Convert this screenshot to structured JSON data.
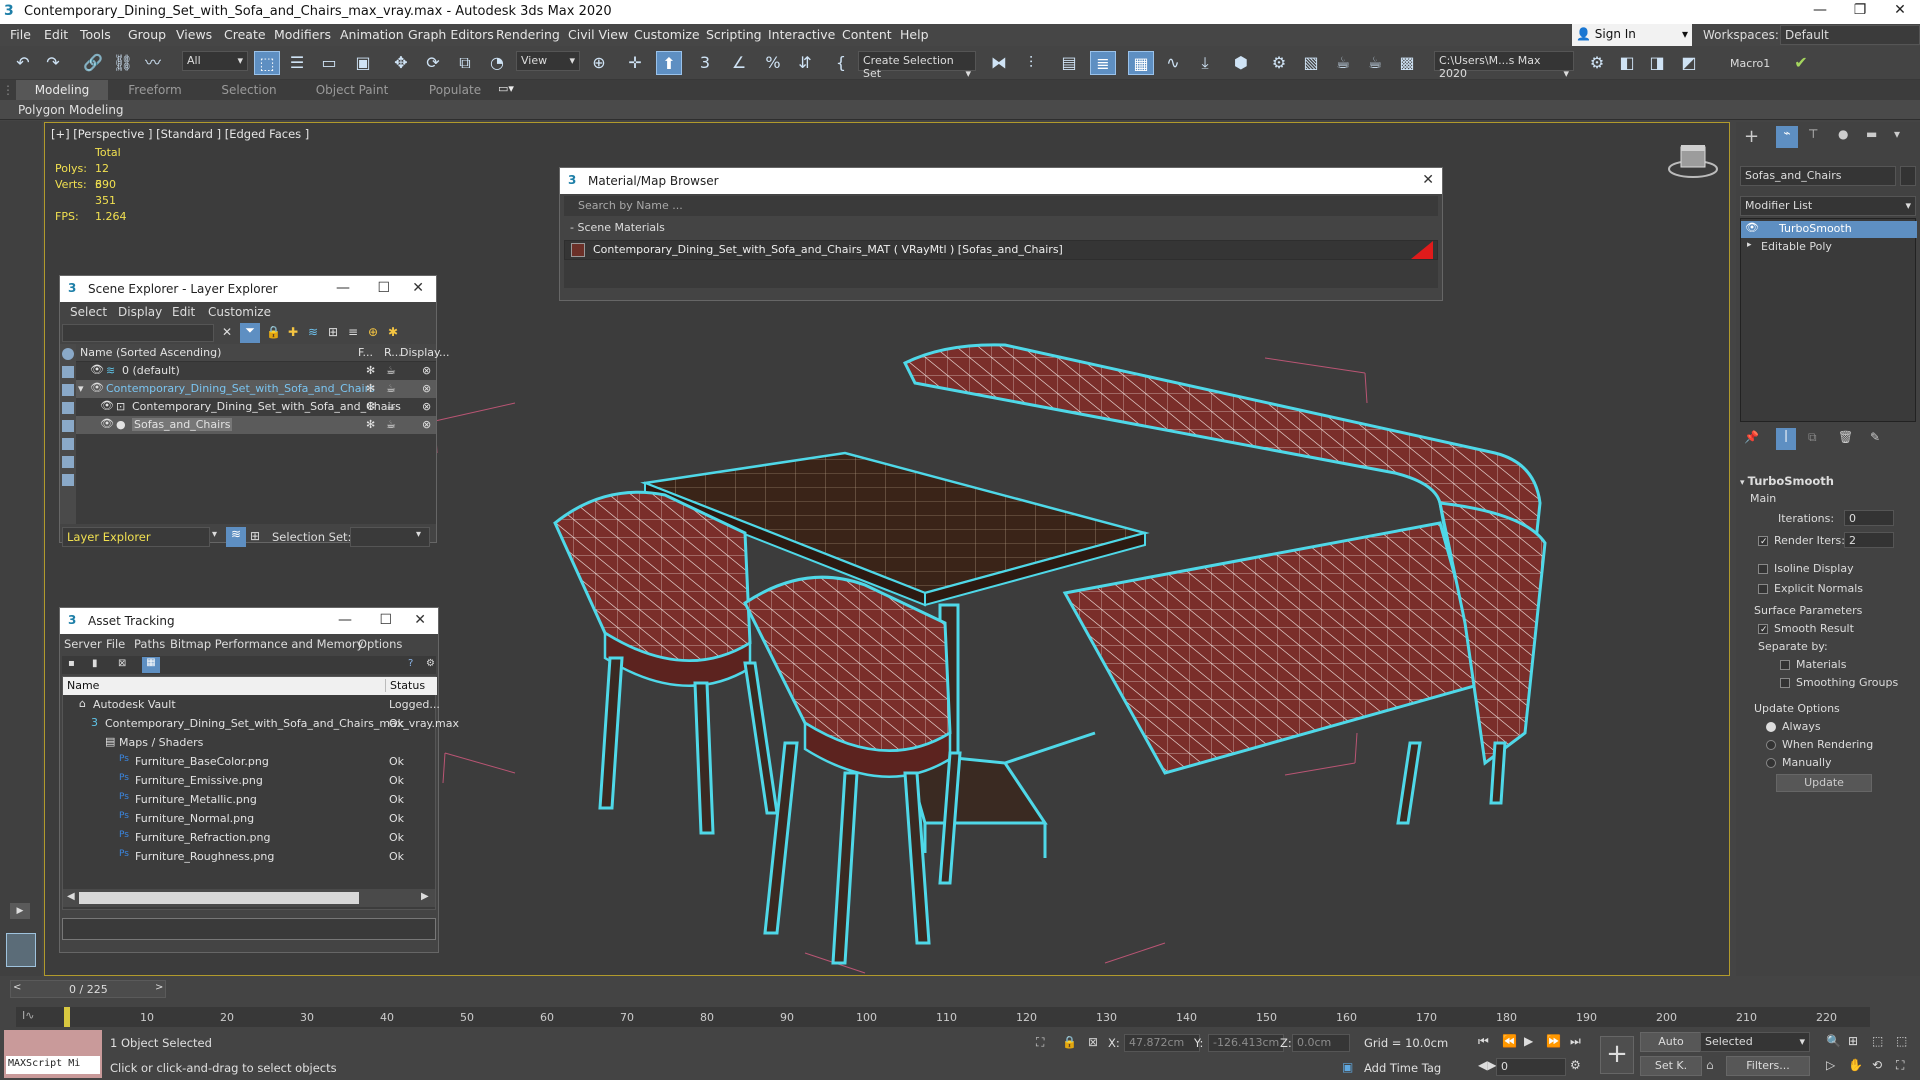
{
  "window": {
    "title": "Contemporary_Dining_Set_with_Sofa_and_Chairs_max_vray.max - Autodesk 3ds Max 2020"
  },
  "menu": [
    "File",
    "Edit",
    "Tools",
    "Group",
    "Views",
    "Create",
    "Modifiers",
    "Animation",
    "Graph Editors",
    "Rendering",
    "Civil View",
    "Customize",
    "Scripting",
    "Interactive",
    "Content",
    "Help"
  ],
  "account": {
    "signin": "Sign In",
    "workspaces_label": "Workspaces:",
    "workspace": "Default"
  },
  "toolbar": {
    "filter": "All",
    "view": "View",
    "selection_set": "Create Selection Set",
    "path": "C:\\Users\\M...s Max 2020",
    "macro": "Macro1"
  },
  "ribbon": {
    "tabs": [
      "Modeling",
      "Freeform",
      "Selection",
      "Object Paint",
      "Populate"
    ],
    "active": "Modeling",
    "subbar": "Polygon Modeling"
  },
  "viewport": {
    "label": "[+] [Perspective ] [Standard ] [Edged Faces ]",
    "stats": {
      "total": "Total",
      "polys_label": "Polys:",
      "polys": "12 390",
      "verts_label": "Verts:",
      "verts": "6 351",
      "fps_label": "FPS:",
      "fps": "1.264"
    }
  },
  "material_browser": {
    "title": "Material/Map Browser",
    "search_placeholder": "Search by Name ...",
    "section": "- Scene Materials",
    "item": "Contemporary_Dining_Set_with_Sofa_and_Chairs_MAT  ( VRayMtl )  [Sofas_and_Chairs]"
  },
  "scene_explorer": {
    "title": "Scene Explorer - Layer Explorer",
    "menu": [
      "Select",
      "Display",
      "Edit",
      "Customize"
    ],
    "col_name": "Name (Sorted Ascending)",
    "col_f": "F...",
    "col_r": "R...",
    "col_display": "Display...",
    "rows": [
      "0 (default)",
      "Contemporary_Dining_Set_with_Sofa_and_Chairs",
      "Contemporary_Dining_Set_with_Sofa_and_Chairs",
      "Sofas_and_Chairs"
    ],
    "footer_explorer": "Layer Explorer",
    "footer_selset": "Selection Set:"
  },
  "asset_tracking": {
    "title": "Asset Tracking",
    "menu": [
      "Server",
      "File",
      "Paths",
      "Bitmap Performance and Memory",
      "Options"
    ],
    "col_name": "Name",
    "col_status": "Status",
    "rows": [
      {
        "name": "Autodesk Vault",
        "status": "Logged..."
      },
      {
        "name": "Contemporary_Dining_Set_with_Sofa_and_Chairs_max_vray.max",
        "status": "Ok"
      },
      {
        "name": "Maps / Shaders",
        "status": ""
      },
      {
        "name": "Furniture_BaseColor.png",
        "status": "Ok"
      },
      {
        "name": "Furniture_Emissive.png",
        "status": "Ok"
      },
      {
        "name": "Furniture_Metallic.png",
        "status": "Ok"
      },
      {
        "name": "Furniture_Normal.png",
        "status": "Ok"
      },
      {
        "name": "Furniture_Refraction.png",
        "status": "Ok"
      },
      {
        "name": "Furniture_Roughness.png",
        "status": "Ok"
      }
    ]
  },
  "command_panel": {
    "object_name": "Sofas_and_Chairs",
    "modifier_list": "Modifier List",
    "stack": [
      "TurboSmooth",
      "Editable Poly"
    ],
    "rollout": "TurboSmooth",
    "main": "Main",
    "iterations_label": "Iterations:",
    "iterations": "0",
    "render_iters_label": "Render Iters:",
    "render_iters": "2",
    "isoline": "Isoline Display",
    "explicit_normals": "Explicit Normals",
    "surface_params": "Surface Parameters",
    "smooth_result": "Smooth Result",
    "separate_by": "Separate by:",
    "materials": "Materials",
    "smoothing_groups": "Smoothing Groups",
    "update_options": "Update Options",
    "always": "Always",
    "when_rendering": "When Rendering",
    "manually": "Manually",
    "update": "Update"
  },
  "timeline": {
    "frame": "0 / 225",
    "ticks": [
      "10",
      "20",
      "30",
      "40",
      "50",
      "60",
      "70",
      "80",
      "90",
      "100",
      "110",
      "120",
      "130",
      "140",
      "150",
      "160",
      "170",
      "180",
      "190",
      "200",
      "210",
      "220"
    ]
  },
  "status": {
    "maxscript": "MAXScript Mi",
    "selected": "1 Object Selected",
    "hint": "Click or click-and-drag to select objects",
    "x_label": "X:",
    "x": "47.872cm",
    "y_label": "Y:",
    "y": "-126.413cm",
    "z_label": "Z:",
    "z": "0.0cm",
    "grid": "Grid = 10.0cm",
    "add_time_tag": "Add Time Tag",
    "auto": "Auto",
    "selected_drop": "Selected",
    "setk": "Set K.",
    "filters": "Filters...",
    "frame_field": "0"
  }
}
